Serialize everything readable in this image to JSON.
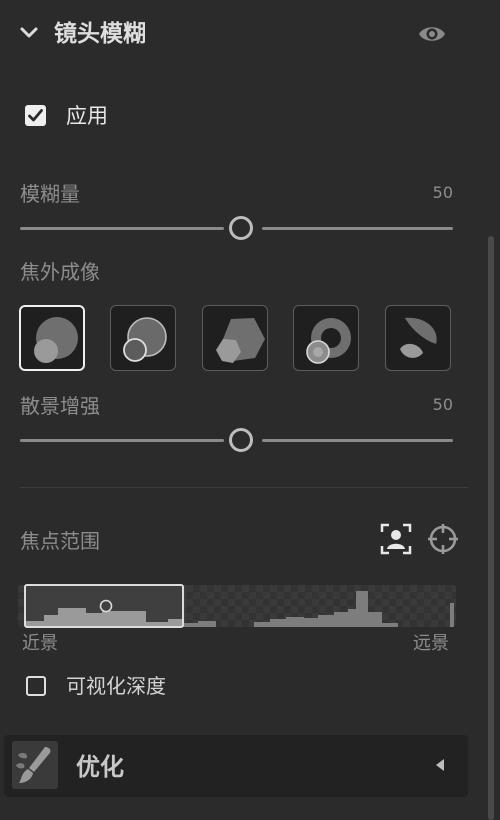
{
  "header": {
    "title": "镜头模糊",
    "collapse_icon": "chevron-down-icon",
    "visibility_icon": "eye-icon"
  },
  "apply": {
    "label": "应用",
    "checked": true
  },
  "blur_amount": {
    "label": "模糊量",
    "value": "50",
    "level": 0.5
  },
  "bokeh": {
    "label": "焦外成像",
    "options": [
      "circle",
      "bubble",
      "polygon",
      "ring",
      "cat-eye"
    ],
    "selected": 0
  },
  "boost": {
    "label": "散景增强",
    "value": "50",
    "level": 0.5
  },
  "focus_range": {
    "label": "焦点范围",
    "subject_icon": "person-focus-icon",
    "point_icon": "crosshair-icon",
    "near_label": "近景",
    "far_label": "远景"
  },
  "visualize_depth": {
    "label": "可视化深度",
    "checked": false
  },
  "next_panel": {
    "title": "优化",
    "icon": "brush-icon"
  },
  "colors": {
    "background": "#2b2b2b",
    "selected_border": "#f0f0f0"
  }
}
